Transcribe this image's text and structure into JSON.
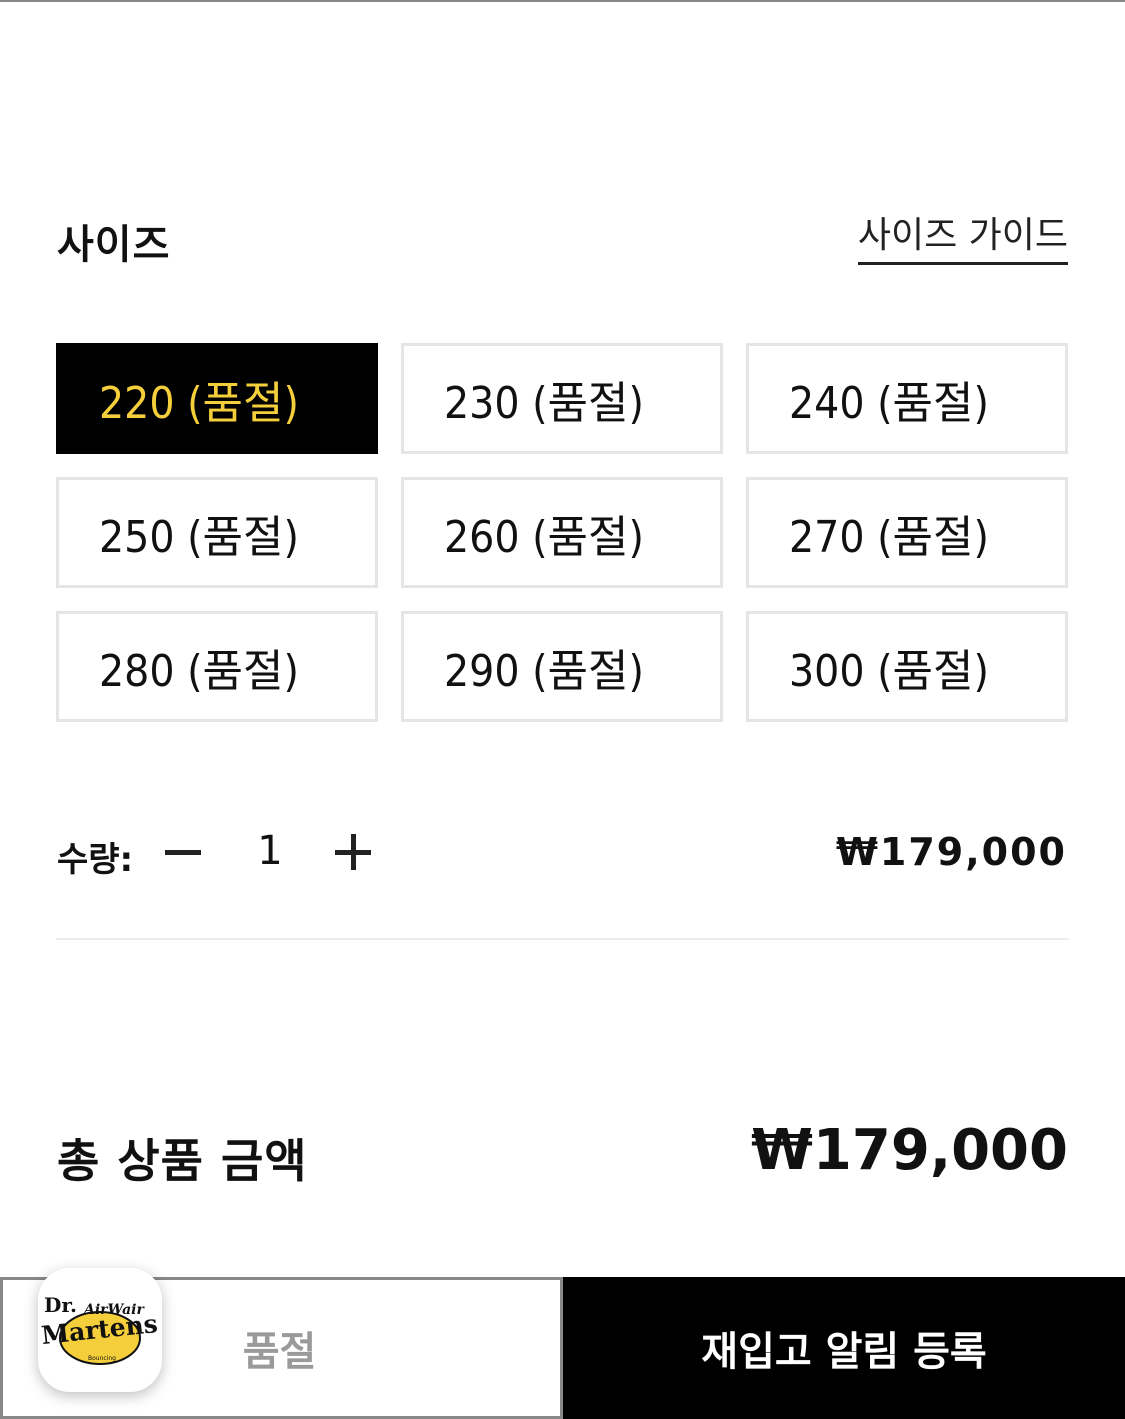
{
  "size_section": {
    "title": "사이즈",
    "guide_link": "사이즈 가이드",
    "options": [
      {
        "label": "220 (품절)",
        "selected": true
      },
      {
        "label": "230 (품절)",
        "selected": false
      },
      {
        "label": "240 (품절)",
        "selected": false
      },
      {
        "label": "250 (품절)",
        "selected": false
      },
      {
        "label": "260 (품절)",
        "selected": false
      },
      {
        "label": "270 (품절)",
        "selected": false
      },
      {
        "label": "280 (품절)",
        "selected": false
      },
      {
        "label": "290 (품절)",
        "selected": false
      },
      {
        "label": "300 (품절)",
        "selected": false
      }
    ]
  },
  "quantity": {
    "label": "수량:",
    "value": "1",
    "price": "₩179,000"
  },
  "total": {
    "label": "총 상품 금액",
    "price": "₩179,000"
  },
  "bottom_bar": {
    "soldout_label": "품절",
    "restock_label": "재입고 알림 등록"
  },
  "brand": {
    "logo_text_1": "Dr.",
    "logo_text_2": "AirWair",
    "logo_text_3": "Martens"
  },
  "colors": {
    "selected_bg": "#000000",
    "selected_text": "#f5cf3b",
    "logo_yellow": "#f5cf3b"
  }
}
